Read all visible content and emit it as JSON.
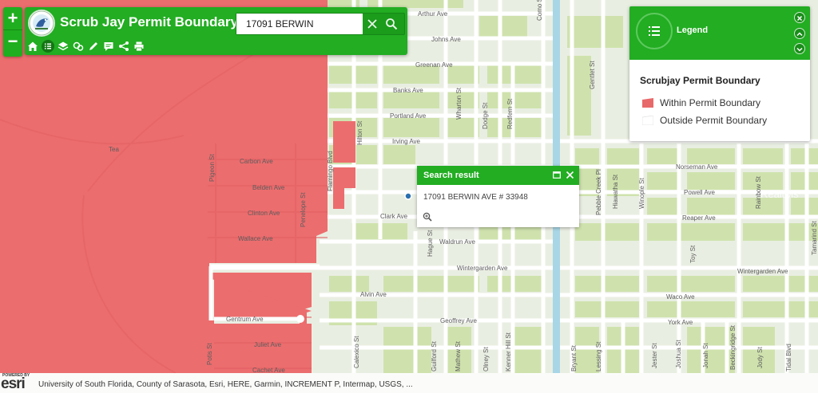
{
  "app": {
    "title": "Scrub Jay Permit Boundary"
  },
  "zoom": {
    "in_label": "+",
    "out_label": "−"
  },
  "search": {
    "value": "17091 BERWIN",
    "clear_icon": "close-icon",
    "search_icon": "search-icon"
  },
  "toolbar": {
    "items": [
      "home-icon",
      "list-icon",
      "layers-icon",
      "basemap-icon",
      "draw-icon",
      "comment-icon",
      "share-icon",
      "print-icon"
    ]
  },
  "legend": {
    "title": "Legend",
    "layer_title": "Scrubjay Permit Boundary",
    "items": [
      {
        "label": "Within Permit Boundary",
        "color": "#e8696a"
      },
      {
        "label": "Outside Permit Boundary",
        "color": "#ffffff"
      }
    ]
  },
  "popup": {
    "title": "Search result",
    "text": "17091 BERWIN AVE # 33948"
  },
  "map": {
    "colors": {
      "boundary": "#ec6d6e",
      "land": "#e7ecdf",
      "green": "#c8dea8",
      "road": "#ffffff",
      "canal": "#a8d6e6"
    },
    "streets_h": [
      {
        "name": "Arthur Ave"
      },
      {
        "name": "Johns Ave"
      },
      {
        "name": "Greenan Ave"
      },
      {
        "name": "Banks Ave"
      },
      {
        "name": "Portland Ave"
      },
      {
        "name": "Irving Ave"
      },
      {
        "name": "Carbon Ave"
      },
      {
        "name": "Belden Ave"
      },
      {
        "name": "Clinton Ave"
      },
      {
        "name": "Wallace Ave"
      },
      {
        "name": "Clark Ave"
      },
      {
        "name": "Waldrun Ave"
      },
      {
        "name": "Wintergarden Ave"
      },
      {
        "name": "Wintergarden Ave"
      },
      {
        "name": "Alvin Ave"
      },
      {
        "name": "Geoffrey Ave"
      },
      {
        "name": "Gentrum Ave"
      },
      {
        "name": "Juliet Ave"
      },
      {
        "name": "Cachet Ave"
      },
      {
        "name": "Norseman Ave"
      },
      {
        "name": "Powell Ave"
      },
      {
        "name": "Reaper Ave"
      },
      {
        "name": "Waco Ave"
      },
      {
        "name": "York Ave"
      },
      {
        "name": "Tea"
      }
    ],
    "streets_v": [
      {
        "name": "Flamingo Blvd"
      },
      {
        "name": "Hilton St"
      },
      {
        "name": "Wharton St"
      },
      {
        "name": "Dodge St"
      },
      {
        "name": "Redfern St"
      },
      {
        "name": "Pebble Creek Pl"
      },
      {
        "name": "Hiawatha St"
      },
      {
        "name": "Winople St"
      },
      {
        "name": "Rainbow St"
      },
      {
        "name": "Hague St"
      },
      {
        "name": "Calexico St"
      },
      {
        "name": "Guilford St"
      },
      {
        "name": "Mathew St"
      },
      {
        "name": "Olney St"
      },
      {
        "name": "Kenner Hill St"
      },
      {
        "name": "Pigeon St"
      },
      {
        "name": "Penelope St"
      },
      {
        "name": "Potis St"
      },
      {
        "name": "Jester St"
      },
      {
        "name": "Joshua St"
      },
      {
        "name": "Jonah St"
      },
      {
        "name": "Beckingridge St"
      },
      {
        "name": "Jody St"
      },
      {
        "name": "Toy St"
      },
      {
        "name": "Tamarind St"
      },
      {
        "name": "Gentlet St"
      },
      {
        "name": "Como St"
      },
      {
        "name": "Lessing St"
      },
      {
        "name": "Tidal Blvd"
      },
      {
        "name": "Bryant St"
      }
    ],
    "watermark": "RealtMs"
  },
  "attribution": {
    "powered": "POWERED BY",
    "brand": "esri",
    "text": "University of South Florida, County of Sarasota, Esri, HERE, Garmin, INCREMENT P, Intermap, USGS, ..."
  }
}
